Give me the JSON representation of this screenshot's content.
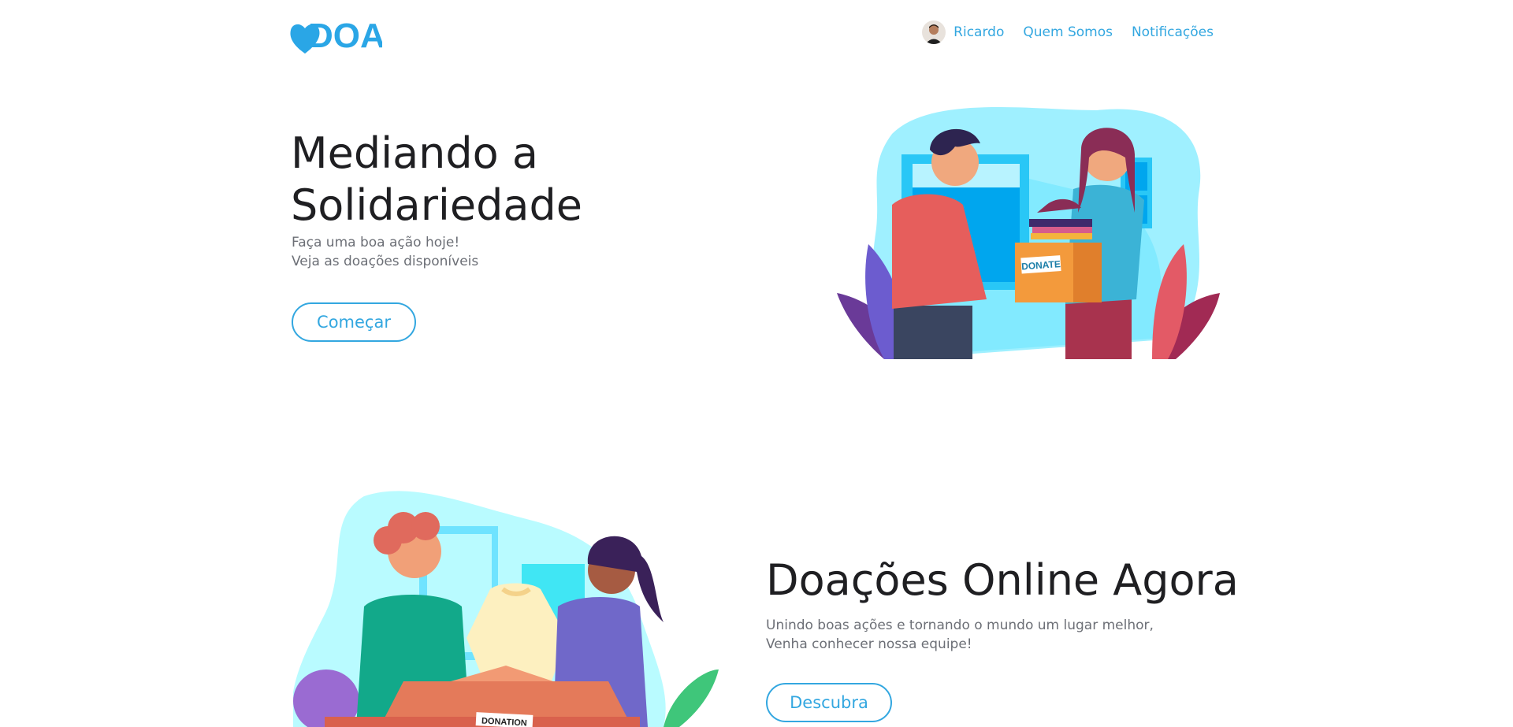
{
  "header": {
    "logo_text": "DOA",
    "user_name": "Ricardo",
    "nav_items": [
      "Quem Somos",
      "Notificações"
    ]
  },
  "hero": {
    "title_line1": "Mediando a",
    "title_line2": "Solidariedade",
    "subtitle_line1": "Faça uma boa ação hoje!",
    "subtitle_line2": "Veja as doações disponíveis",
    "cta_label": "Começar",
    "illustration_box_text": "DONATE"
  },
  "section2": {
    "title": "Doações Online Agora",
    "subtitle_line1": "Unindo boas ações e tornando o mundo um lugar melhor,",
    "subtitle_line2": "Venha conhecer nossa equipe!",
    "cta_label": "Descubra",
    "illustration_box_text": "DONATION"
  },
  "colors": {
    "accent": "#33a7e0",
    "heading": "#1f1f22",
    "muted": "#6c6f76",
    "blob": "#9ff0ff"
  }
}
